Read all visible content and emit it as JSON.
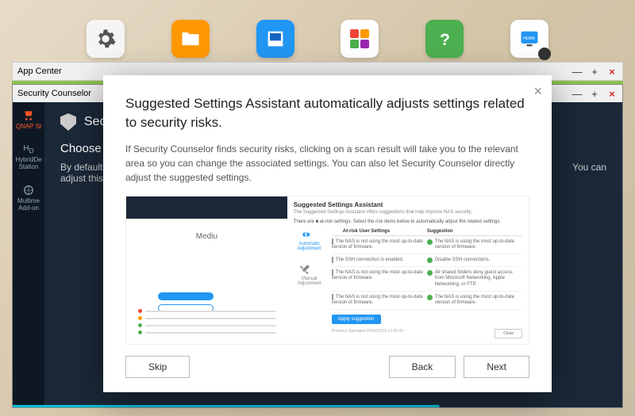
{
  "taskbar": {
    "icons": [
      "gear-icon",
      "folder-icon",
      "storage-icon",
      "grid-icon",
      "help-icon",
      "hdmi-icon"
    ]
  },
  "appcenter": {
    "title": "App Center"
  },
  "seccounselor": {
    "title": "Security Counselor",
    "header": "Securit",
    "sidebar": {
      "qnap": "QNAP St",
      "hybrid": "HybridDe\nStation",
      "multimedia": "Multime\nAdd-on"
    },
    "subheader": "Choose",
    "body1": "By default",
    "body2": "adjust this",
    "body3": "You can"
  },
  "modal": {
    "title": "Suggested Settings Assistant automatically adjusts settings related to security risks.",
    "desc": "If Security Counselor finds security risks, clicking on a scan result will take you to the relevant area so you can change the associated settings. You can also let Security Counselor directly adjust the suggested settings.",
    "skip": "Skip",
    "back": "Back",
    "next": "Next",
    "preview": {
      "medium": "Mediu",
      "title": "Suggested Settings Assistant",
      "sub": "The Suggested Settings Assistant offers suggestions that help improve NAS security.",
      "hint": "There are ■ at-risk settings. Select the risk items below to automatically adjust the related settings.",
      "auto": "Automatic\nAdjustment",
      "manual": "Manual\nAdjustment",
      "col1": "At-risk User Settings",
      "col2": "Suggestion",
      "rows": [
        {
          "risk": "The NAS is not using the most up-to-date version of firmware.",
          "sugg": "The NAS is using the most up-to-date version of firmware.",
          "checked": true
        },
        {
          "risk": "The SSH connection is enabled.",
          "sugg": "Disable SSH connections.",
          "checked": false
        },
        {
          "risk": "The NAS is not using the most up-to-date version of firmware.",
          "sugg": "All shared folders deny guest access from Microsoft Networking, Apple Networking, or FTP.",
          "checked": true
        },
        {
          "risk": "The NAS is not using the most up-to-date version of firmware.",
          "sugg": "The NAS is using the most up-to-date version of firmware.",
          "checked": true
        }
      ],
      "apply": "Apply suggestion",
      "timestamp": "Previous Operation:2018/02/23 12:42:30",
      "close": "Close"
    }
  }
}
